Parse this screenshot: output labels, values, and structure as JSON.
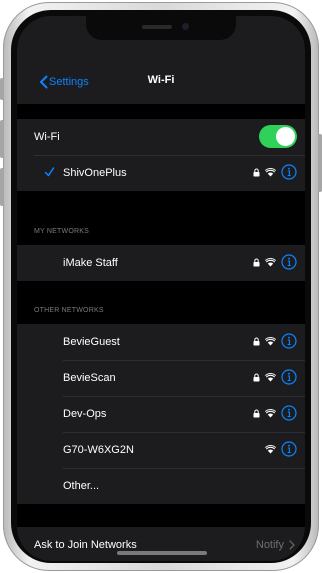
{
  "nav": {
    "back_label": "Settings",
    "title": "Wi-Fi"
  },
  "wifi": {
    "label": "Wi-Fi",
    "enabled": true,
    "current_network": {
      "name": "ShivOnePlus",
      "secured": true
    }
  },
  "my_networks": {
    "header": "MY NETWORKS",
    "items": [
      {
        "name": "iMake Staff",
        "secured": true
      }
    ]
  },
  "other_networks": {
    "header": "OTHER NETWORKS",
    "items": [
      {
        "name": "BevieGuest",
        "secured": true
      },
      {
        "name": "BevieScan",
        "secured": true
      },
      {
        "name": "Dev-Ops",
        "secured": true
      },
      {
        "name": "G70-W6XG2N",
        "secured": false
      }
    ],
    "other_label": "Other..."
  },
  "ask_to_join": {
    "label": "Ask to Join Networks",
    "value": "Notify"
  },
  "colors": {
    "accent": "#0a84ff",
    "toggle_on": "#30d158"
  }
}
